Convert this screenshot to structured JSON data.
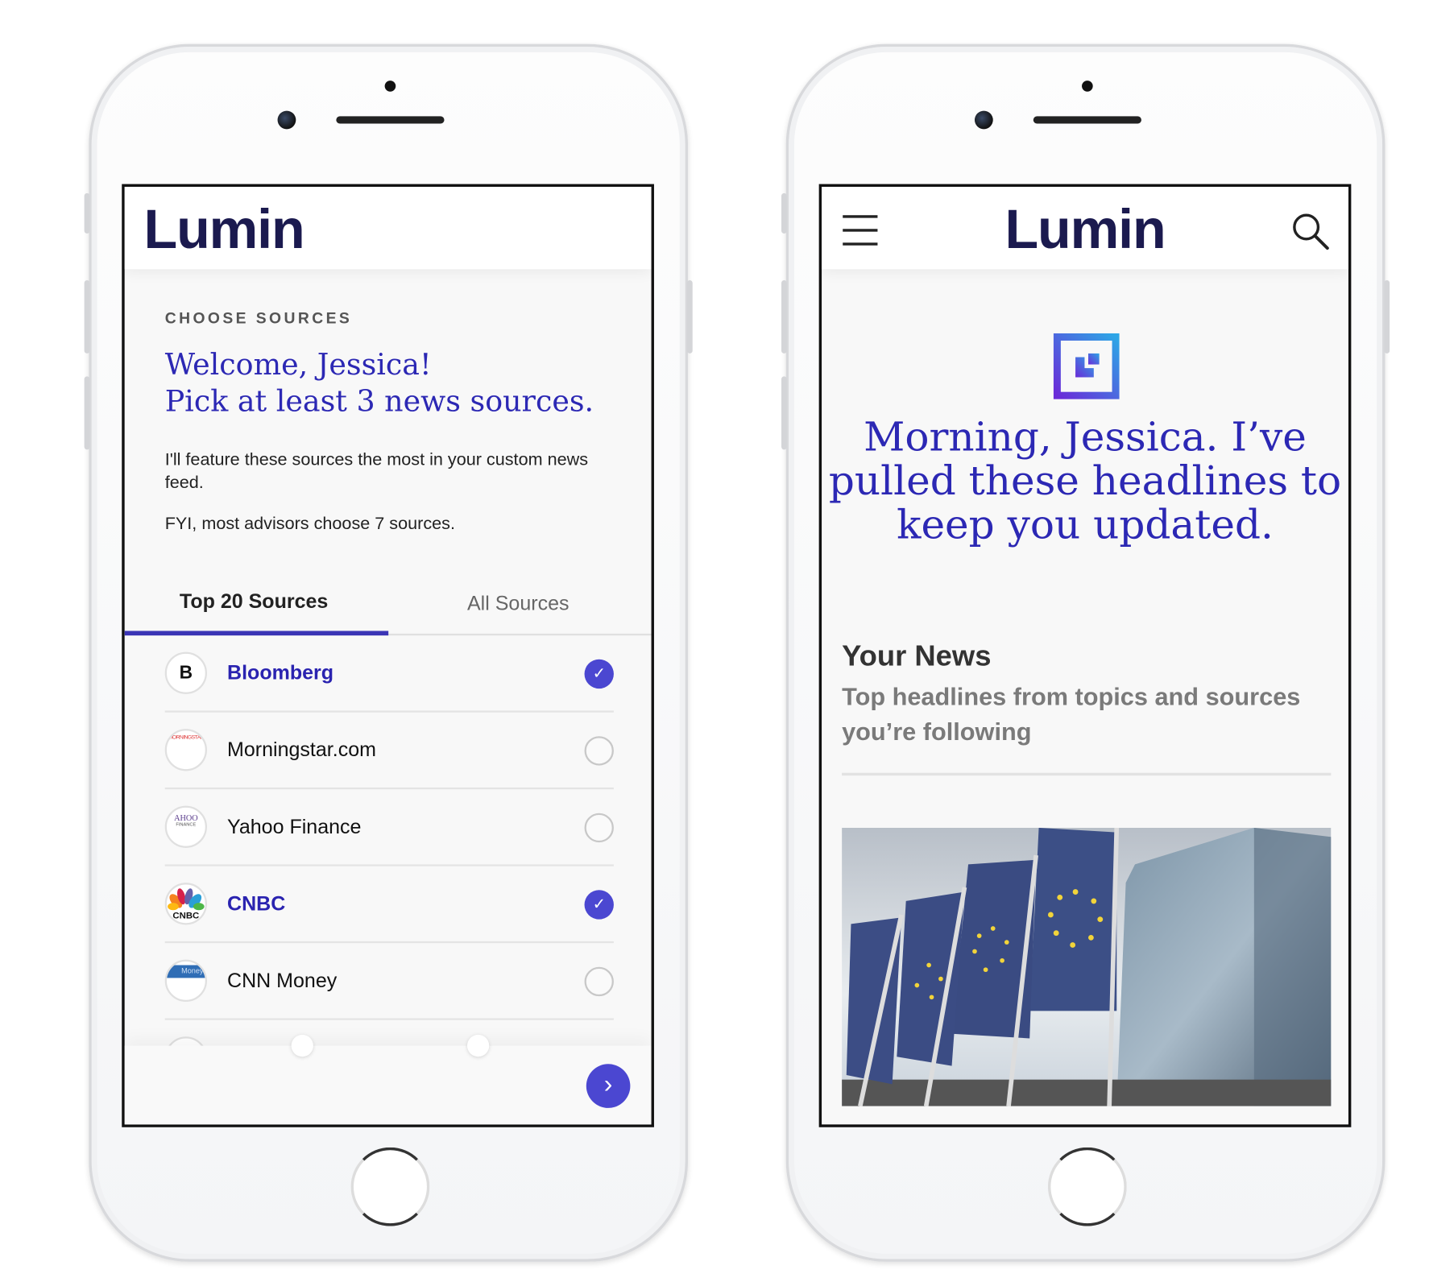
{
  "colors": {
    "accent": "#4b47d1",
    "brand_navy": "#1b1a4f",
    "headline_blue": "#2c28b4"
  },
  "left_screen": {
    "logo": "Lumin",
    "section_label": "CHOOSE SOURCES",
    "welcome_line1": "Welcome, Jessica!",
    "welcome_line2": "Pick at least 3 news sources.",
    "description": "I'll feature these sources the most in your custom news feed.",
    "fyi": "FYI, most advisors choose 7 sources.",
    "tabs": [
      {
        "label": "Top 20 Sources",
        "active": true
      },
      {
        "label": "All Sources",
        "active": false
      }
    ],
    "sources": [
      {
        "name": "Bloomberg",
        "logo": "B",
        "selected": true
      },
      {
        "name": "Morningstar.com",
        "logo": "MORNINGSTAR",
        "selected": false
      },
      {
        "name": "Yahoo Finance",
        "logo": "YAHOO FINANCE",
        "selected": false
      },
      {
        "name": "CNBC",
        "logo": "CNBC",
        "selected": true
      },
      {
        "name": "CNN Money",
        "logo": "CNN Money",
        "selected": false
      }
    ],
    "next_icon": "chevron-right-icon",
    "check_glyph": "✓",
    "next_glyph": "›"
  },
  "right_screen": {
    "logo": "Lumin",
    "menu_icon": "hamburger-menu-icon",
    "search_icon": "search-icon",
    "headline_line1": "Morning, Jessica. I’ve",
    "headline_line2": "pulled these headlines to",
    "headline_line3": "keep you updated.",
    "section_title": "Your News",
    "section_subtitle_line1": "Top headlines from topics and sources",
    "section_subtitle_line2": "you’re following"
  }
}
